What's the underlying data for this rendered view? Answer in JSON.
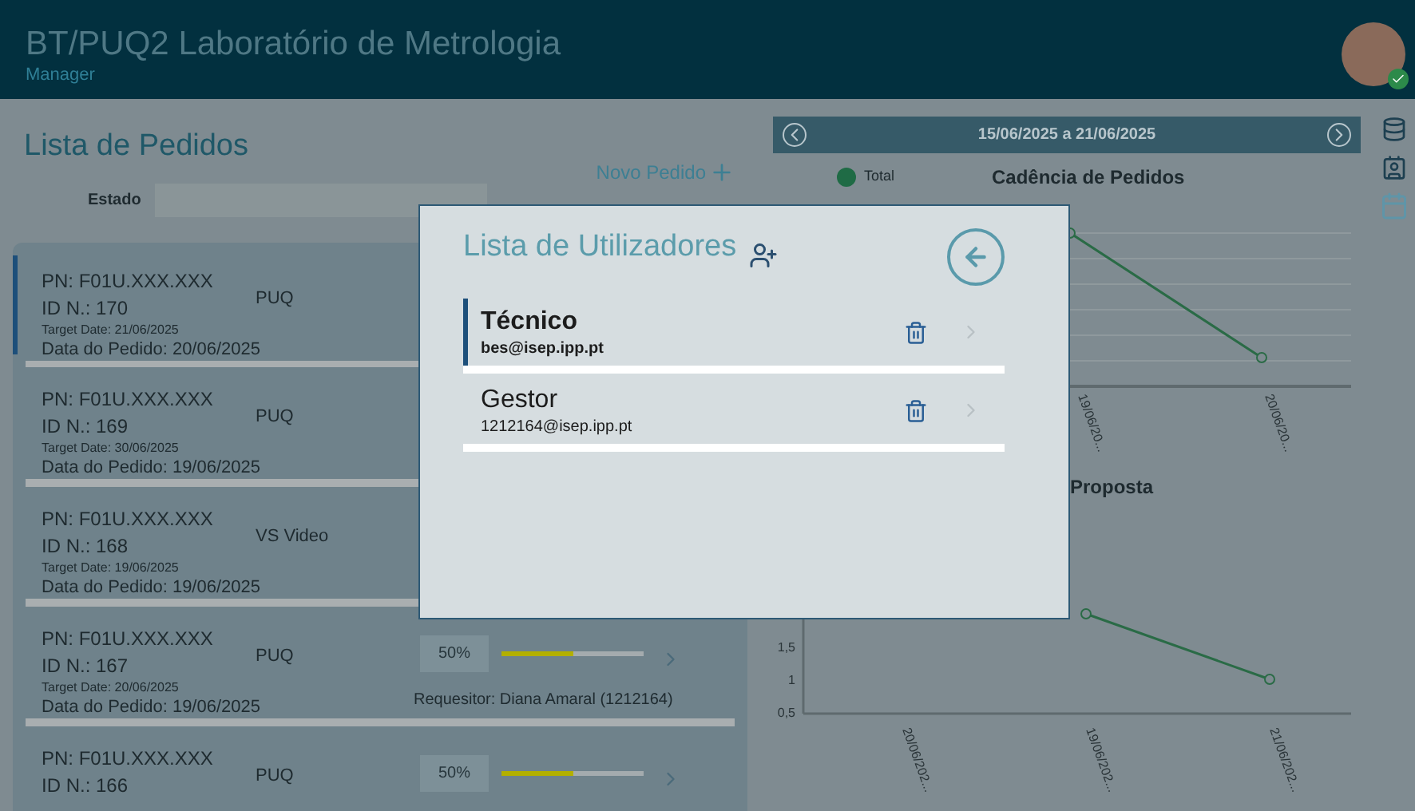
{
  "header": {
    "title": "BT/PUQ2 Laboratório de Metrologia",
    "subtitle": "Manager"
  },
  "orders": {
    "title": "Lista de Pedidos",
    "new_button": "Novo Pedido",
    "filter_label": "Estado",
    "items": [
      {
        "pn": "PN: F01U.XXX.XXX",
        "id": "ID N.: 170",
        "type": "PUQ",
        "target_date": "Target Date: 21/06/2025",
        "order_date": "Data do Pedido: 20/06/2025",
        "selected": true
      },
      {
        "pn": "PN: F01U.XXX.XXX",
        "id": "ID N.: 169",
        "type": "PUQ",
        "target_date": "Target Date: 30/06/2025",
        "order_date": "Data do Pedido: 19/06/2025",
        "selected": false
      },
      {
        "pn": "PN: F01U.XXX.XXX",
        "id": "ID N.: 168",
        "type": "VS Video",
        "target_date": "Target Date: 19/06/2025",
        "order_date": "Data do Pedido: 19/06/2025",
        "selected": false
      },
      {
        "pn": "PN: F01U.XXX.XXX",
        "id": "ID N.: 167",
        "type": "PUQ",
        "target_date": "Target Date: 20/06/2025",
        "order_date": "Data do Pedido: 19/06/2025",
        "selected": false,
        "progress": "50%",
        "level": 0.5,
        "requester": "Requesitor: Diana Amaral (1212164)"
      },
      {
        "pn": "PN: F01U.XXX.XXX",
        "id": "ID N.: 166",
        "type": "PUQ",
        "selected": false,
        "progress": "50%",
        "level": 0.5
      }
    ]
  },
  "date_range": {
    "label": "15/06/2025 a 21/06/2025"
  },
  "charts": [
    {
      "title": "Cadência de Pedidos",
      "legend": "Total",
      "x_labels": [
        "19/06/20...",
        "20/06/20..."
      ]
    },
    {
      "title": "Proposta",
      "chart_data": {
        "type": "line",
        "categories": [
          "20/06/202...",
          "19/06/202...",
          "21/06/202..."
        ],
        "series": [
          {
            "values": [
              null,
              2,
              1
            ],
            "marker": true
          }
        ],
        "ylim": [
          0.5,
          2.5
        ],
        "yticks": [
          {
            "value": 0.5,
            "label": "0,5"
          },
          {
            "value": 1,
            "label": "1"
          },
          {
            "value": 1.5,
            "label": "1,5"
          }
        ]
      }
    }
  ],
  "modal": {
    "title": "Lista de Utilizadores",
    "users": [
      {
        "role": "Técnico",
        "email": "bes@isep.ipp.pt",
        "selected": true
      },
      {
        "role": "Gestor",
        "email": "1212164@isep.ipp.pt",
        "selected": false
      }
    ]
  }
}
